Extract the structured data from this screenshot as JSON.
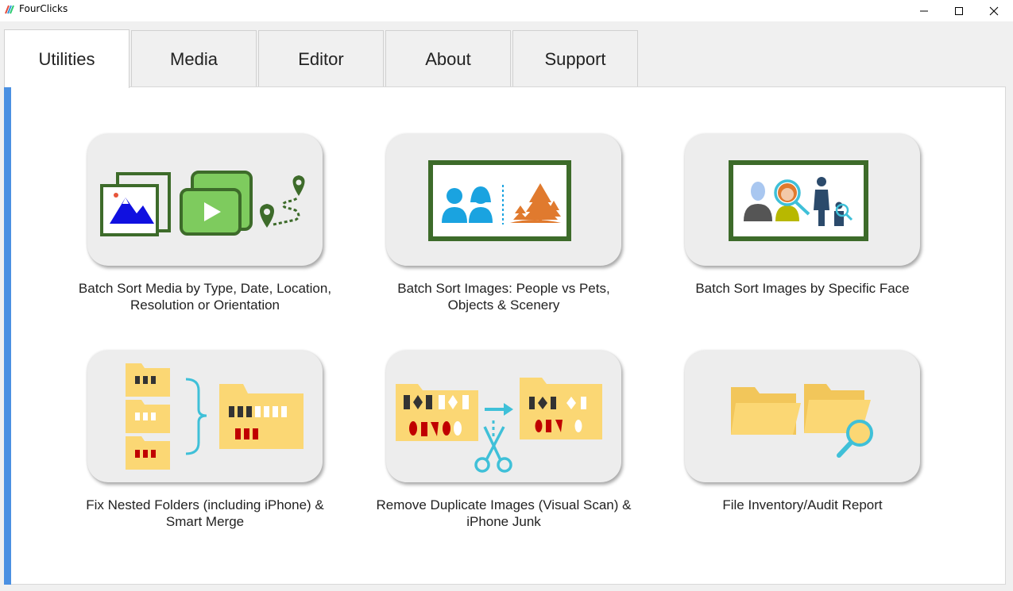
{
  "window": {
    "title": "FourClicks"
  },
  "tabs": [
    {
      "label": "Utilities",
      "active": true
    },
    {
      "label": "Media"
    },
    {
      "label": "Editor"
    },
    {
      "label": "About"
    },
    {
      "label": "Support"
    }
  ],
  "cards": [
    {
      "caption_line1": "Batch Sort Media by Type, Date, Location,",
      "caption_line2": "Resolution or Orientation"
    },
    {
      "caption_line1": "Batch Sort Images: People vs Pets,",
      "caption_line2": "Objects & Scenery"
    },
    {
      "caption_line1": "Batch Sort Images by Specific Face",
      "caption_line2": ""
    },
    {
      "caption_line1": "Fix Nested Folders (including iPhone) &",
      "caption_line2": "Smart Merge"
    },
    {
      "caption_line1": "Remove Duplicate Images (Visual Scan) &",
      "caption_line2": "iPhone Junk"
    },
    {
      "caption_line1": "File Inventory/Audit Report",
      "caption_line2": ""
    }
  ],
  "colors": {
    "accent": "#4a90e2",
    "frame_green": "#3d6b2a",
    "folder_yellow": "#fbd774",
    "icon_cyan": "#3fc0d8",
    "tree_orange": "#e07a2e",
    "person_blue": "#1aa3e0"
  }
}
